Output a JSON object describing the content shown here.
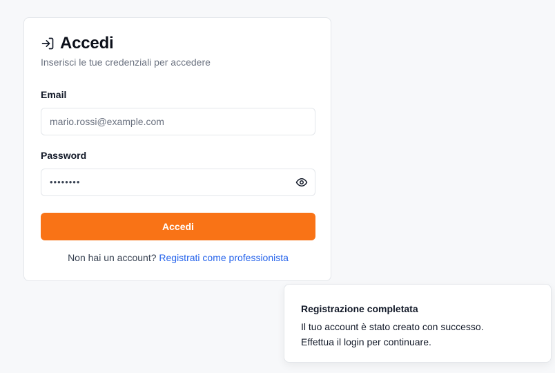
{
  "login": {
    "title": "Accedi",
    "subtitle": "Inserisci le tue credenziali per accedere",
    "email_label": "Email",
    "email_placeholder": "mario.rossi@example.com",
    "password_label": "Password",
    "password_value": "••••••••",
    "submit_label": "Accedi",
    "footer_text": "Non hai un account?",
    "footer_link": "Registrati come professionista"
  },
  "toast": {
    "title": "Registrazione completata",
    "message_line1": "Il tuo account è stato creato con successo.",
    "message_line2": "Effettua il login per continuare."
  },
  "colors": {
    "accent": "#f97316",
    "link": "#2563eb",
    "background": "#f7f8fa"
  },
  "icons": {
    "title_icon": "login-icon",
    "password_toggle": "eye-icon"
  }
}
